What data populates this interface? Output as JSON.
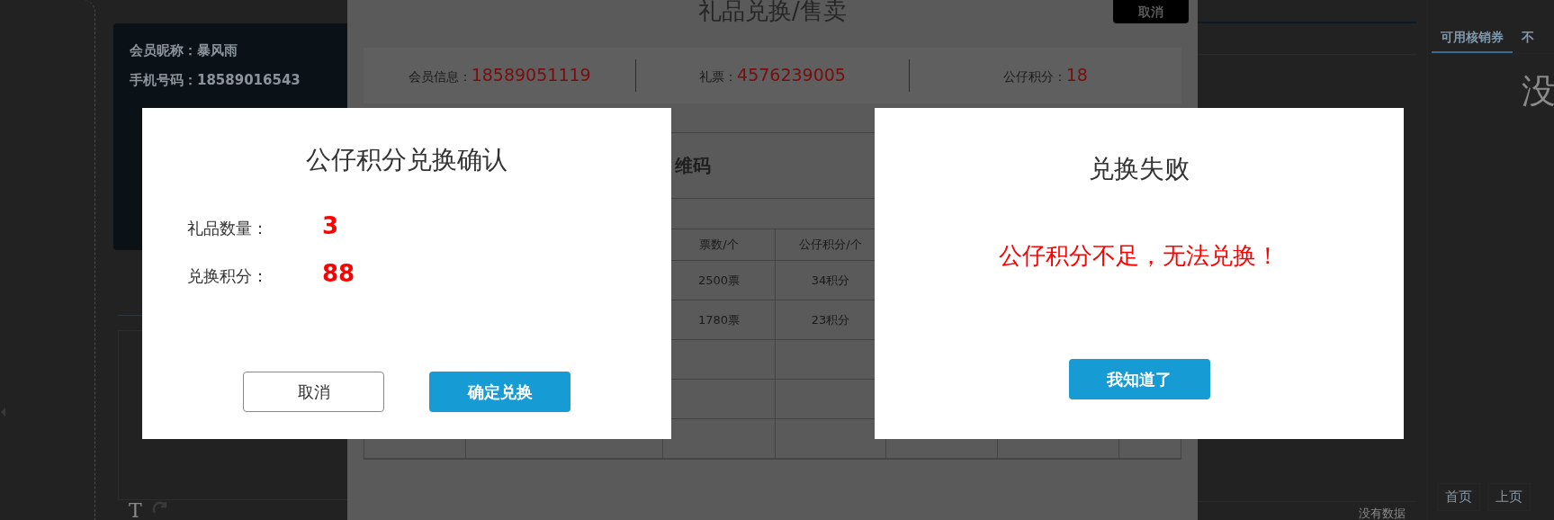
{
  "background": {
    "member_card": {
      "rows": [
        {
          "label": "会员昵称：",
          "value": "暴风雨"
        },
        {
          "label": "手机号码：",
          "value": "18589016543"
        }
      ]
    },
    "editor_toolbar": {
      "text_tool": "T"
    },
    "list_footer": {
      "empty_text": "没有数据"
    },
    "coupon_panel": {
      "tabs": [
        {
          "label": "可用核销券",
          "selected": true
        },
        {
          "label": "不",
          "selected": false
        }
      ],
      "empty_text": "没",
      "pagination": [
        "首页",
        "上页"
      ]
    }
  },
  "gift_modal": {
    "title": "礼品兑换/售卖",
    "cancel_button": "取消",
    "info": [
      {
        "label": "会员信息：",
        "value": "18589051119"
      },
      {
        "label": "礼票：",
        "value": "4576239005"
      },
      {
        "label": "公仔积分：",
        "value": "18"
      }
    ],
    "qr_section_title": "维码",
    "table": {
      "columns": [
        "票数/个",
        "公仔积分/个"
      ],
      "rows": [
        [
          "2500票",
          "34积分"
        ],
        [
          "1780票",
          "23积分"
        ]
      ]
    }
  },
  "confirm_dialog": {
    "title": "公仔积分兑换确认",
    "fields": [
      {
        "label": "礼品数量：",
        "value": "3"
      },
      {
        "label": "兑换积分：",
        "value": "88"
      }
    ],
    "buttons": [
      {
        "label": "取消",
        "kind": "secondary"
      },
      {
        "label": "确定兑换",
        "kind": "primary"
      }
    ]
  },
  "error_dialog": {
    "title": "兑换失败",
    "message": "公仔积分不足，无法兑换！",
    "button": "我知道了"
  }
}
